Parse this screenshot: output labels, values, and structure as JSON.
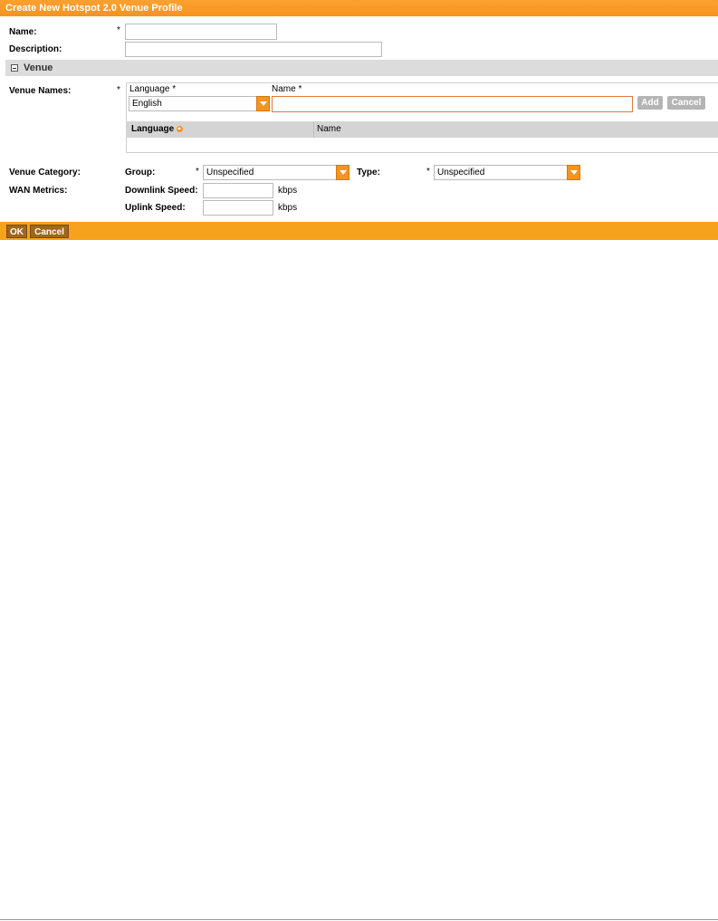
{
  "dialog": {
    "title": "Create New Hotspot 2.0 Venue Profile"
  },
  "form": {
    "name_label": "Name:",
    "required_mark": "*",
    "name_value": "",
    "description_label": "Description:",
    "description_value": ""
  },
  "venue_section": {
    "title": "Venue",
    "venue_names_label": "Venue Names:",
    "language_header": "Language *",
    "name_header": "Name *",
    "language_selected": "English",
    "name_value": "",
    "add_button": "Add",
    "cancel_button": "Cancel",
    "table": {
      "columns": [
        "Language",
        "Name"
      ],
      "rows": []
    }
  },
  "venue_category": {
    "label": "Venue Category:",
    "group_label": "Group:",
    "group_selected": "Unspecified",
    "type_label": "Type:",
    "type_selected": "Unspecified"
  },
  "wan_metrics": {
    "label": "WAN Metrics:",
    "downlink_label": "Downlink Speed:",
    "downlink_value": "",
    "uplink_label": "Uplink Speed:",
    "uplink_value": "",
    "unit": "kbps"
  },
  "footer": {
    "ok_button": "OK",
    "cancel_button": "Cancel"
  },
  "colors": {
    "accent": "#f7931e",
    "footer": "#f7a21c",
    "button_dark": "#a0661a",
    "section_bg": "#dcdcdc"
  },
  "icons": [
    "collapse-icon",
    "dropdown-arrow-icon",
    "sort-asc-icon"
  ]
}
